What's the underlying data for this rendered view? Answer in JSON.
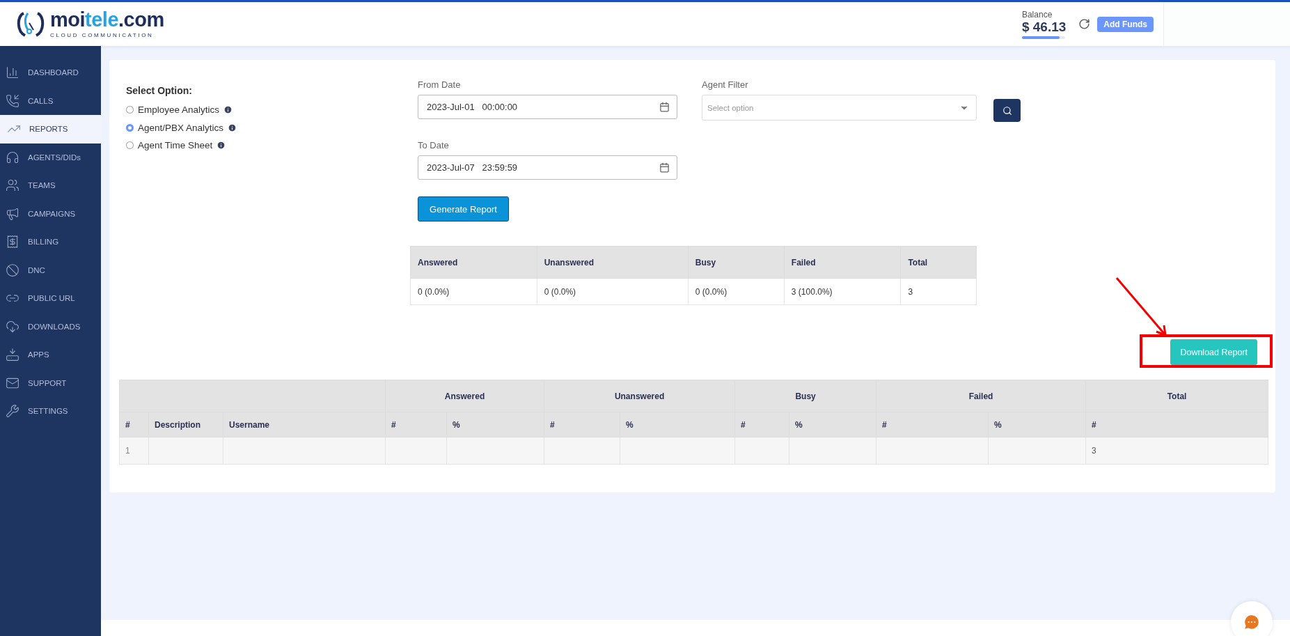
{
  "header": {
    "logo": {
      "parts": [
        "moi",
        "tele",
        ".com"
      ],
      "tagline": "CLOUD COMMUNICATION"
    },
    "balance": {
      "label": "Balance",
      "amount": "$ 46.13",
      "level": 0.88
    },
    "add_funds": "Add Funds"
  },
  "sidebar": {
    "items": [
      {
        "label": "DASHBOARD",
        "selected": false
      },
      {
        "label": "CALLS",
        "selected": false
      },
      {
        "label": "REPORTS",
        "selected": true
      },
      {
        "label": "AGENTS/DIDs",
        "selected": false
      },
      {
        "label": "TEAMS",
        "selected": false
      },
      {
        "label": "CAMPAIGNS",
        "selected": false
      },
      {
        "label": "BILLING",
        "selected": false
      },
      {
        "label": "DNC",
        "selected": false
      },
      {
        "label": "PUBLIC URL",
        "selected": false
      },
      {
        "label": "DOWNLOADS",
        "selected": false
      },
      {
        "label": "APPS",
        "selected": false
      },
      {
        "label": "SUPPORT",
        "selected": false
      },
      {
        "label": "SETTINGS",
        "selected": false
      }
    ]
  },
  "options": {
    "title": "Select Option:",
    "radios": [
      {
        "label": "Employee Analytics",
        "selected": false
      },
      {
        "label": "Agent/PBX Analytics",
        "selected": true
      },
      {
        "label": "Agent Time Sheet",
        "selected": false
      }
    ]
  },
  "from_date": {
    "label": "From Date",
    "value": "2023-Jul-01   00:00:00"
  },
  "to_date": {
    "label": "To Date",
    "value": "2023-Jul-07   23:59:59"
  },
  "agent_filter": {
    "label": "Agent Filter",
    "placeholder": "Select option"
  },
  "generate_button": "Generate Report",
  "summary": {
    "columns": [
      "Answered",
      "Unanswered",
      "Busy",
      "Failed",
      "Total"
    ],
    "rows": [
      [
        "0 (0.0%)",
        "0 (0.0%)",
        "0 (0.0%)",
        "3 (100.0%)",
        "3"
      ]
    ]
  },
  "download_button": "Download Report",
  "detail_table": {
    "groups": [
      "Answered",
      "Unanswered",
      "Busy",
      "Failed",
      "Total"
    ],
    "subheaders": [
      "#",
      "Description",
      "Username",
      "#",
      "%",
      "#",
      "%",
      "#",
      "%",
      "#",
      "%",
      "#"
    ],
    "rows": [
      {
        "number": "1",
        "total": "3"
      }
    ]
  }
}
